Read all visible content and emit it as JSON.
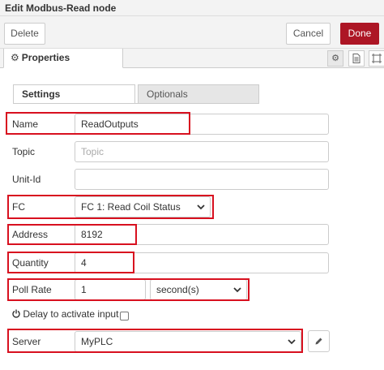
{
  "titlebar": {
    "title": "Edit Modbus-Read node"
  },
  "toolbar": {
    "delete_label": "Delete",
    "cancel_label": "Cancel",
    "done_label": "Done"
  },
  "tabs": {
    "properties_label": "Properties"
  },
  "subtabs": {
    "settings_label": "Settings",
    "optionals_label": "Optionals"
  },
  "form": {
    "name_label": "Name",
    "name_value": "ReadOutputs",
    "topic_label": "Topic",
    "topic_placeholder": "Topic",
    "unitid_label": "Unit-Id",
    "unitid_value": "",
    "fc_label": "FC",
    "fc_value": "FC 1: Read Coil Status",
    "address_label": "Address",
    "address_value": "8192",
    "quantity_label": "Quantity",
    "quantity_value": "4",
    "pollrate_label": "Poll Rate",
    "pollrate_value": "1",
    "pollrate_unit": "second(s)",
    "delay_label": "Delay to activate input",
    "delay_checked": false,
    "server_label": "Server",
    "server_value": "MyPLC"
  },
  "colors": {
    "done": "#ad1625",
    "highlight": "#d8101f"
  },
  "icons": [
    "gear-icon",
    "document-icon",
    "frame-icon",
    "power-icon",
    "chevron-down-icon",
    "pencil-icon"
  ]
}
